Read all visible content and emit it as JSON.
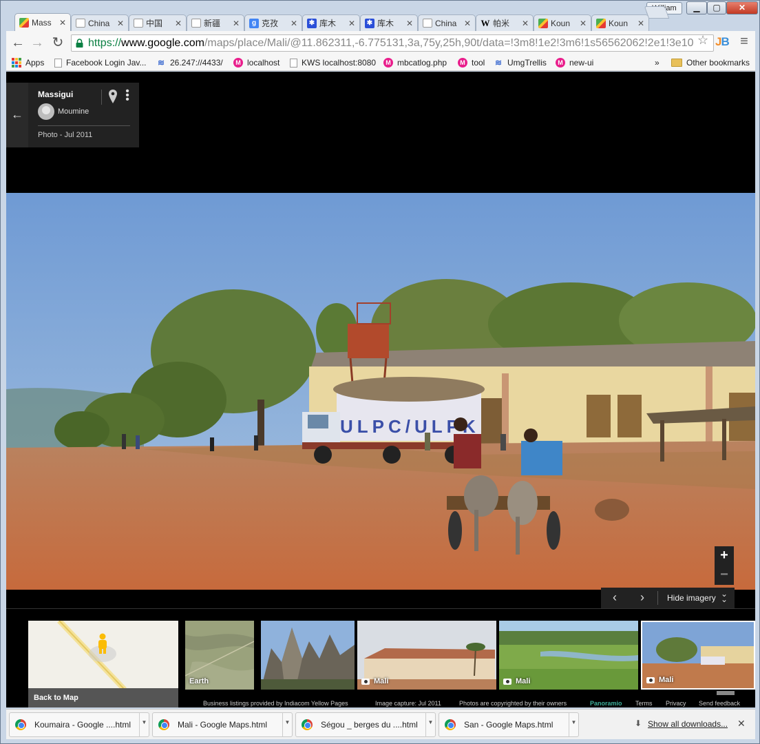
{
  "window": {
    "user": "William",
    "minimize": "▁",
    "maximize": "▢",
    "close": "✕"
  },
  "tabs": [
    {
      "title": "Mass",
      "icon": "maps-icon",
      "active": true
    },
    {
      "title": "China",
      "icon": "page-icon"
    },
    {
      "title": "中国",
      "icon": "page-icon"
    },
    {
      "title": "新疆",
      "icon": "page-icon"
    },
    {
      "title": "克孜",
      "icon": "google-icon"
    },
    {
      "title": "库木",
      "icon": "baidu-paw-icon"
    },
    {
      "title": "库木",
      "icon": "baidu-paw-icon"
    },
    {
      "title": "China",
      "icon": "page-icon"
    },
    {
      "title": "帕米",
      "icon": "wikipedia-icon"
    },
    {
      "title": "Koun",
      "icon": "maps-icon"
    },
    {
      "title": "Koun",
      "icon": "maps-icon"
    }
  ],
  "toolbar": {
    "back": "←",
    "forward": "→",
    "reload": "↻",
    "url_scheme": "https://",
    "url_host": "www.google.com",
    "url_path": "/maps/place/Mali/@11.862311,-6.775131,3a,75y,25h,90t/data=!3m8!1e2!3m6!1s56562062!2e1!3e10",
    "star": "☆",
    "menu": "≡"
  },
  "bookmarks": [
    {
      "label": "Apps",
      "icon": "apps-grid-icon"
    },
    {
      "label": "Facebook Login Jav...",
      "icon": "page-icon"
    },
    {
      "label": "26.247://4433/",
      "icon": "trello-icon"
    },
    {
      "label": "localhost",
      "icon": "magento-icon"
    },
    {
      "label": "KWS localhost:8080",
      "icon": "page-icon"
    },
    {
      "label": "mbcatlog.php",
      "icon": "magento-icon"
    },
    {
      "label": "tool",
      "icon": "magento-icon"
    },
    {
      "label": "UmgTrellis",
      "icon": "trello-icon"
    },
    {
      "label": "new-ui",
      "icon": "magento-icon"
    }
  ],
  "bookmarks_overflow": "»",
  "other_bookmarks": "Other bookmarks",
  "infocard": {
    "back": "←",
    "title": "Massigui",
    "user": "Moumine",
    "photo_date": "Photo - Jul 2011",
    "more": "⋮"
  },
  "photo": {
    "truck_text": "ULPC/ULPK"
  },
  "zoom": {
    "in": "+",
    "out": "−"
  },
  "imagery_nav": {
    "prev": "‹",
    "next": "›",
    "hide_label": "Hide imagery",
    "chevron": "⌄⌄"
  },
  "filmstrip": [
    {
      "label": "Back to Map",
      "type": "map"
    },
    {
      "label": "Earth",
      "type": "earth"
    },
    {
      "label": "",
      "type": "photo"
    },
    {
      "label": "Mali",
      "type": "photo"
    },
    {
      "label": "Mali",
      "type": "photo"
    },
    {
      "label": "Mali",
      "type": "photo",
      "selected": true
    }
  ],
  "footer": {
    "listings": "Business listings provided by Indiacom Yellow Pages",
    "capture": "Image capture: Jul 2011",
    "copyright": "Photos are copyrighted by their owners",
    "panoramio": "Panoramio",
    "terms": "Terms",
    "privacy": "Privacy",
    "feedback": "Send feedback"
  },
  "downloads": [
    {
      "name": "Koumaira - Google ....html"
    },
    {
      "name": "Mali - Google Maps.html"
    },
    {
      "name": "Ségou _ berges du ....html"
    },
    {
      "name": "San - Google Maps.html"
    }
  ],
  "downloads_show_all": "Show all downloads...",
  "downloads_close": "✕",
  "colors": {
    "chrome_frame": "#c9d6e6",
    "url_secure": "#0b8043",
    "panoramio": "#3cae9a",
    "sky": "#6f9ad4",
    "dirt": "#c57a4a"
  }
}
